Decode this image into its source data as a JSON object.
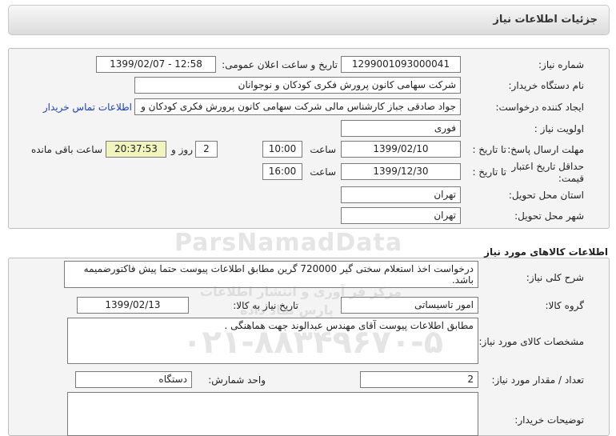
{
  "header": {
    "title": "جزئیات اطلاعات نیاز"
  },
  "need_info": {
    "need_number_label": "شماره نیاز:",
    "need_number": "1299001093000041",
    "announce_label": "تاریخ و ساعت اعلان عمومی:",
    "announce_value": "1399/02/07 - 12:58",
    "buyer_org_label": "نام دستگاه خریدار:",
    "buyer_org": "شرکت سهامی کانون پرورش فکری کودکان و نوجوانان",
    "requester_label": "ایجاد کننده درخواست:",
    "requester": "جواد  صادقی جباز کارشناس مالی شرکت سهامی کانون پرورش فکری کودکان و",
    "contact_link": "اطلاعات تماس خریدار",
    "priority_label": "اولویت نیاز :",
    "priority": "فوری",
    "deadline_label": "مهلت ارسال پاسخ:",
    "to_date_label": "تا تاریخ :",
    "deadline_date": "1399/02/10",
    "time_label": "ساعت",
    "deadline_time": "10:00",
    "days_value": "2",
    "days_label": "روز و",
    "remaining_time": "20:37:53",
    "remaining_label": "ساعت باقی مانده",
    "validity_label": "حداقل تاریخ اعتبار قیمت:",
    "validity_to_label": "تا تاریخ :",
    "validity_date": "1399/12/30",
    "validity_time_label": "ساعت",
    "validity_time": "16:00",
    "province_label": "استان محل تحویل:",
    "province": "تهران",
    "city_label": "شهر محل تحویل:",
    "city": "تهران"
  },
  "goods_info": {
    "section_title": "اطلاعات کالاهای مورد نیاز",
    "summary_label": "شرح کلی نیاز:",
    "summary": "درخواست  اخذ استعلام  سختی گیر 720000 گرین مطابق اطلاعات پیوست حتما پیش فاکتورضمیمه باشد.",
    "group_label": "گروه کالا:",
    "group": "امور تاسیساتی",
    "need_date_label": "تاریخ نیاز به کالا:",
    "need_date": "1399/02/13",
    "specs_label": "مشخصات کالای مورد نیاز:",
    "specs": "مطابق اطلاعات پیوست آقای مهندس عبدالوند جهت هماهنگی .",
    "qty_label": "تعداد / مقدار مورد نیاز:",
    "qty": "2",
    "unit_label": "واحد شمارش:",
    "unit": "دستگاه",
    "buyer_notes_label": "توضیحات خریدار:",
    "buyer_notes": ""
  },
  "watermark": {
    "brand": "ParsNamadData",
    "phone": "۰۲۱-۸۸۳۴۹۶۷۰-۵",
    "line1": "مرکز فر آوری و انتشار اطلاعات",
    "line2": "پارس نماد داده"
  }
}
